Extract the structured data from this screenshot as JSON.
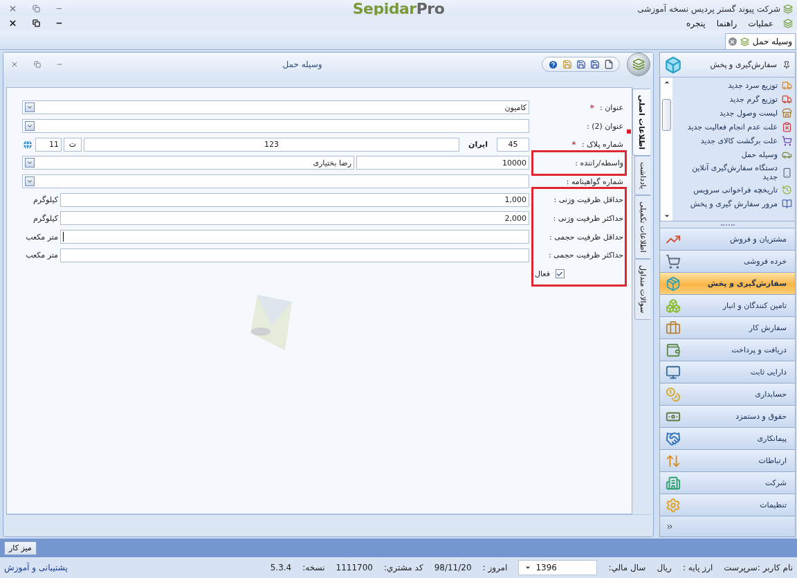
{
  "app": {
    "title": "شرکت پیوند گستر پردیس نسخه آموزشی",
    "logo": {
      "lead": "Sepidar",
      "tail": "Pro"
    }
  },
  "menu": [
    {
      "label": "عملیات"
    },
    {
      "label": "راهنما"
    },
    {
      "label": "پنجره"
    }
  ],
  "doc_tabs": [
    {
      "label": "وسیله حمل",
      "selected": true
    }
  ],
  "form_window": {
    "title": "وسیله حمل",
    "side_tabs": [
      {
        "label": "اطلاعات اصلی",
        "selected": true
      },
      {
        "label": "یادداشت",
        "selected": false
      },
      {
        "label": "اطلاعات تکمیلی",
        "selected": false
      },
      {
        "label": "سوالات متداول",
        "selected": false
      }
    ],
    "fields": [
      {
        "kind": "combo",
        "label": "عنوان :",
        "mark": "*",
        "highlighted": false,
        "value": "کامیون"
      },
      {
        "kind": "combo",
        "label": "عنوان (2) :",
        "highlighted": false
      },
      {
        "kind": "plate",
        "label": "شماره پلاک :",
        "mark": "*",
        "highlighted": false,
        "segments": [
          {
            "kind": "box",
            "text": "45"
          },
          {
            "kind": "label",
            "text": "ایران"
          },
          {
            "kind": "wide",
            "text": "123"
          },
          {
            "kind": "box",
            "text": "ت"
          },
          {
            "kind": "box",
            "text": "11"
          }
        ]
      },
      {
        "kind": "driver",
        "label": "واسطه/راننده :",
        "highlighted": true,
        "code": "10000",
        "value": "رضا  بختیاری"
      },
      {
        "kind": "combo",
        "label": "شماره گواهینامه :",
        "highlighted": false
      },
      {
        "kind": "number",
        "label": "حداقل ظرفیت وزنی :",
        "highlighted": true,
        "value": "1,000",
        "unit": "کیلوگرم",
        "focused": false
      },
      {
        "kind": "number",
        "label": "حداکثر ظرفیت وزنی :",
        "highlighted": true,
        "value": "2,000",
        "unit": "کیلوگرم",
        "focused": false
      },
      {
        "kind": "number",
        "label": "حداقل ظرفیت حجمی :",
        "highlighted": true,
        "unit": "متر مکعب",
        "focused": true
      },
      {
        "kind": "number",
        "label": "حداکثر ظرفیت حجمی :",
        "highlighted": true,
        "unit": "متر مکعب",
        "focused": false
      },
      {
        "kind": "checkbox",
        "label": "فعال",
        "highlighted": true,
        "checked": true
      }
    ]
  },
  "sidebar": {
    "title": "سفارش‌گیری و پخش",
    "tasks": [
      {
        "label": "توزیع سرد جدید"
      },
      {
        "label": "توزیع گرم جدید"
      },
      {
        "label": "لیست وصول جدید"
      },
      {
        "label": "علت عدم انجام فعالیت جدید"
      },
      {
        "label": "علت برگشت کالای جدید"
      },
      {
        "label": "وسیله حمل"
      },
      {
        "label": "دستگاه سفارش‌گیری آنلاین جدید"
      },
      {
        "label": "تاریخچه فراخوانی سرویس"
      },
      {
        "label": "مرور سفارش گیری و پخش"
      }
    ],
    "modules": [
      {
        "label": "مشتریان و فروش",
        "selected": false
      },
      {
        "label": "خرده فروشی",
        "selected": false
      },
      {
        "label": "سفارش‌گیری و پخش",
        "selected": true
      },
      {
        "label": "تامین کنندگان و انبار",
        "selected": false
      },
      {
        "label": "سفارش کار",
        "selected": false
      },
      {
        "label": "دریافت و پرداخت",
        "selected": false
      },
      {
        "label": "دارایی ثابت",
        "selected": false
      },
      {
        "label": "حسابداری",
        "selected": false
      },
      {
        "label": "حقوق و دستمزد",
        "selected": false
      },
      {
        "label": "پیمانکاری",
        "selected": false
      },
      {
        "label": "ارتباطات",
        "selected": false
      },
      {
        "label": "شرکت",
        "selected": false
      },
      {
        "label": "تنظیمات",
        "selected": false
      }
    ]
  },
  "taskbar": {
    "button": "میز کار"
  },
  "status_bar": {
    "items": [
      {
        "kind": "text",
        "text": "نام کاربر :سرپرست"
      },
      {
        "kind": "text",
        "text": "ارز پایه :"
      },
      {
        "kind": "text",
        "text": "ریال"
      },
      {
        "kind": "text",
        "text": "سال مالي:"
      },
      {
        "kind": "select",
        "text": "1396"
      },
      {
        "kind": "text",
        "text": "امروز :"
      },
      {
        "kind": "text",
        "text": "98/11/20"
      },
      {
        "kind": "text",
        "text": "کد مشتري:"
      },
      {
        "kind": "text",
        "text": "1111700"
      },
      {
        "kind": "text",
        "text": "نسخه:"
      },
      {
        "kind": "text",
        "text": "5.3.4"
      }
    ],
    "link": "پشتیبانی و آموزش"
  }
}
